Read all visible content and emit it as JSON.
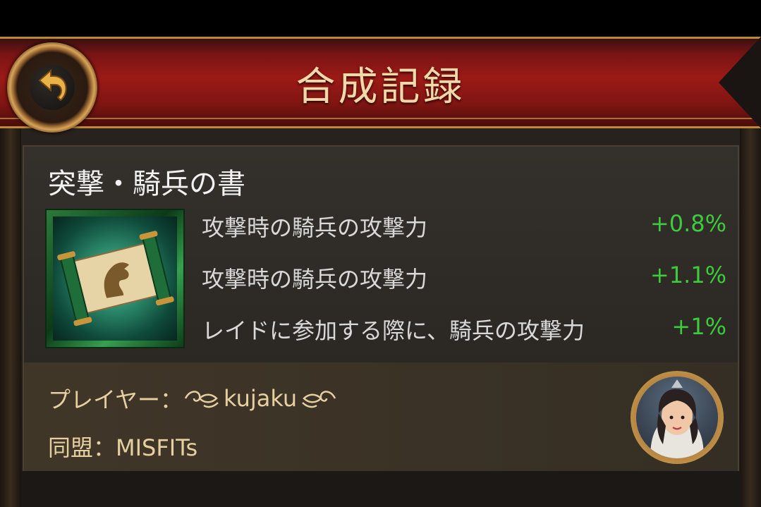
{
  "header": {
    "title": "合成記録",
    "back_icon": "back-arrow-icon"
  },
  "book": {
    "title": "突撃・騎兵の書",
    "icon": "cavalry-scroll-icon",
    "stats": [
      {
        "label": "攻撃時の騎兵の攻撃力",
        "value": "+0.8%"
      },
      {
        "label": "攻撃時の騎兵の攻撃力",
        "value": "+1.1%"
      },
      {
        "label": "レイドに参加する際に、騎兵の攻撃力",
        "value": "+1%"
      }
    ],
    "value_color": "#3ccb3c"
  },
  "player": {
    "prefix": "プレイヤー：",
    "name": "kujaku",
    "alliance_text": "同盟：MISFITs",
    "avatar_icon": "player-avatar-icon"
  },
  "colors": {
    "banner": "#9c1a16",
    "title_text": "#f0d8a8",
    "gold_text": "#e6cfa0"
  }
}
